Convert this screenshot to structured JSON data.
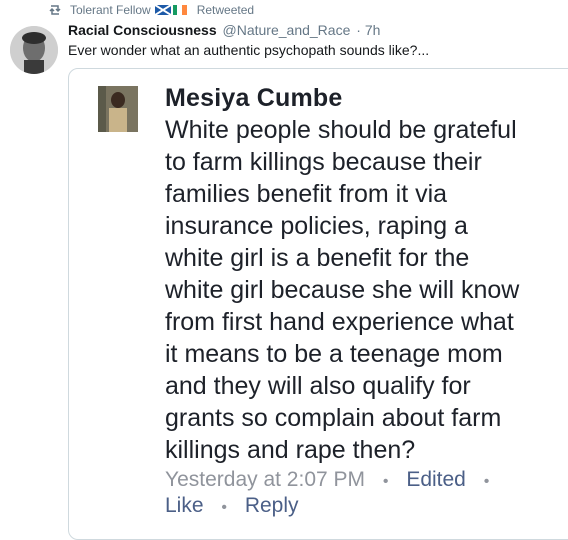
{
  "retweet": {
    "user": "Tolerant Fellow",
    "label": "Retweeted",
    "icon": "retweet-icon",
    "flags": [
      "scotland-flag-icon",
      "ireland-flag-icon"
    ]
  },
  "tweet": {
    "author_name": "Racial Consciousness",
    "author_handle": "@Nature_and_Race",
    "time": "· 7h",
    "text": "Ever wonder what an authentic psychopath sounds like?..."
  },
  "embed": {
    "commenter_name": "Mesiya Cumbe",
    "comment_lines": [
      "White people should be grateful",
      "to farm killings because their",
      "families benefit from it via",
      "insurance policies,  raping a",
      "white girl is a benefit for the",
      "white girl because she will know",
      "from first hand experience what",
      "it means to be a teenage mom",
      "and they will also qualify for",
      "grants so complain about farm",
      "killings and rape then?"
    ],
    "timestamp": "Yesterday at 2:07 PM",
    "edited": "Edited",
    "like": "Like",
    "reply": "Reply",
    "separator": "•"
  },
  "colors": {
    "secondary_text": "#657786",
    "fb_link": "#4b5f87",
    "fb_meta": "#90949c",
    "border": "#cfd9de"
  }
}
